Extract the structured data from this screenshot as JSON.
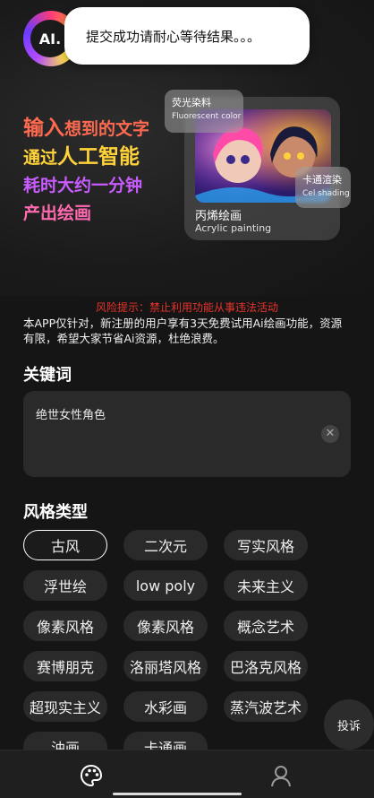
{
  "app": {
    "logo_text": "AI."
  },
  "toast": {
    "message": "提交成功请耐心等待结果。。。"
  },
  "hero": {
    "slogan": [
      {
        "pre": "输入",
        "mid": "想到的文字"
      },
      {
        "pre": "通过",
        "mid": "人工智能"
      },
      {
        "pre": "耗时",
        "mid": "大约一分钟"
      },
      {
        "pre": "产出",
        "mid": "绘画"
      }
    ],
    "tags": {
      "fluorescent_cn": "荧光染料",
      "fluorescent_en": "Fluorescent color",
      "cel_cn": "卡通渲染",
      "cel_en": "Cel shading",
      "acrylic_cn": "丙烯绘画",
      "acrylic_en": "Acrylic painting"
    }
  },
  "risk_notice": "风险提示：禁止利用功能从事违法活动",
  "notice": "本APP仅针对，新注册的用户享有3天免费试用Ai绘画功能，资源有限，希望大家节省Ai资源，杜绝浪费。",
  "keywords": {
    "title": "关键词",
    "value": "绝世女性角色",
    "clear_icon": "close-circle-icon"
  },
  "styles": {
    "title": "风格类型",
    "selected": "古风",
    "options": [
      "古风",
      "二次元",
      "写实风格",
      "浮世绘",
      "low poly",
      "未来主义",
      "像素风格",
      "像素风格",
      "概念艺术",
      "赛博朋克",
      "洛丽塔风格",
      "巴洛克风格",
      "超现实主义",
      "水彩画",
      "蒸汽波艺术",
      "油画",
      "卡通画"
    ]
  },
  "complaint_button": "投诉",
  "nav": {
    "home_icon": "palette-icon",
    "profile_icon": "user-icon"
  },
  "colors": {
    "background": "#151515",
    "risk": "#e8332c",
    "chip": "#2a2a2a"
  }
}
